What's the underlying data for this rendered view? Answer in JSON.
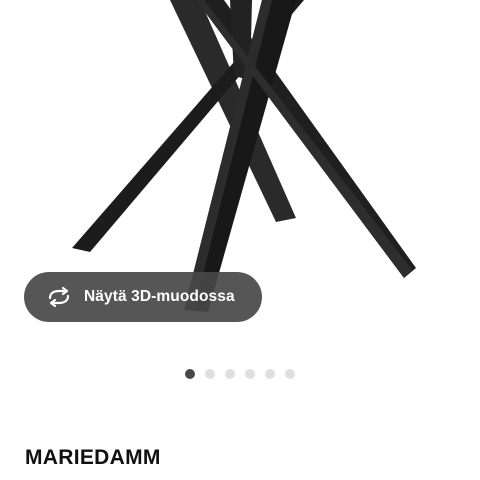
{
  "product": {
    "name": "MARIEDAMM",
    "image_icon": "table-legs-image"
  },
  "view_3d": {
    "label": "Näytä 3D-muodossa",
    "icon": "rotate-3d-icon"
  },
  "carousel": {
    "count": 6,
    "active_index": 0
  },
  "colors": {
    "legs": "#1f1f1f",
    "button_bg": "#484848",
    "dot_active": "#484848",
    "dot_inactive": "#dfdfdf"
  }
}
